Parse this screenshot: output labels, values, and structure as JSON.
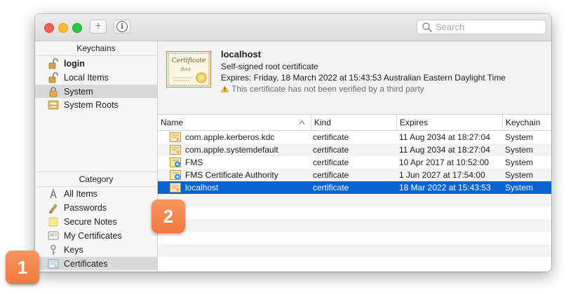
{
  "toolbar": {
    "plus_label": "+",
    "info_label": "i",
    "search_placeholder": "Search"
  },
  "sidebar": {
    "keychains_header": "Keychains",
    "keychains": [
      {
        "label": "login",
        "icon": "unlocked-padlock-icon"
      },
      {
        "label": "Local Items",
        "icon": "unlocked-padlock-icon"
      },
      {
        "label": "System",
        "icon": "locked-padlock-icon",
        "selected": true
      },
      {
        "label": "System Roots",
        "icon": "cabinet-icon"
      }
    ],
    "category_header": "Category",
    "categories": [
      {
        "label": "All Items",
        "icon": "all-items-icon"
      },
      {
        "label": "Passwords",
        "icon": "pen-icon"
      },
      {
        "label": "Secure Notes",
        "icon": "note-icon"
      },
      {
        "label": "My Certificates",
        "icon": "my-certificate-icon"
      },
      {
        "label": "Keys",
        "icon": "key-icon"
      },
      {
        "label": "Certificates",
        "icon": "certificate-icon",
        "selected": true
      }
    ]
  },
  "detail": {
    "title": "localhost",
    "subtitle": "Self-signed root certificate",
    "expires": "Expires: Friday, 18 March 2022 at 15:43:53 Australian Eastern Daylight Time",
    "warning": "This certificate has not been verified by a third party",
    "cert_image_text1": "Certificate",
    "cert_image_text2": "Root"
  },
  "table": {
    "columns": [
      "Name",
      "Kind",
      "Expires",
      "Keychain"
    ],
    "rows": [
      {
        "name": "com.apple.kerberos.kdc",
        "kind": "certificate",
        "expires": "11 Aug 2034 at 18:27:04",
        "keychain": "System",
        "icon": "certificate-icon"
      },
      {
        "name": "com.apple.systemdefault",
        "kind": "certificate",
        "expires": "11 Aug 2034 at 18:27:04",
        "keychain": "System",
        "icon": "certificate-icon"
      },
      {
        "name": "FMS",
        "kind": "certificate",
        "expires": "10 Apr 2017 at 10:52:00",
        "keychain": "System",
        "icon": "certificate-plus-icon"
      },
      {
        "name": "FMS Certificate Authority",
        "kind": "certificate",
        "expires": "1 Jun 2027 at 17:54:00",
        "keychain": "System",
        "icon": "certificate-plus-icon"
      },
      {
        "name": "localhost",
        "kind": "certificate",
        "expires": "18 Mar 2022 at 15:43:53",
        "keychain": "System",
        "icon": "certificate-icon",
        "selected": true
      }
    ]
  },
  "badges": [
    "1",
    "2"
  ],
  "colors": {
    "selection": "#0a62d0",
    "badge": "#f07a3e",
    "sidebar_selection": "#d9d9d9"
  }
}
